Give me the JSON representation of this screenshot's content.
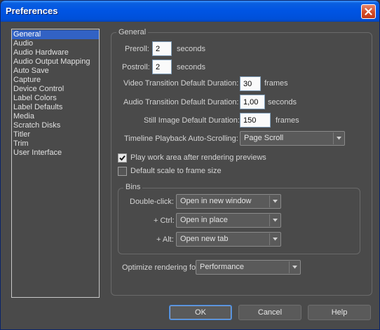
{
  "window": {
    "title": "Preferences"
  },
  "sidebar": {
    "items": [
      {
        "label": "General"
      },
      {
        "label": "Audio"
      },
      {
        "label": "Audio Hardware"
      },
      {
        "label": "Audio Output Mapping"
      },
      {
        "label": "Auto Save"
      },
      {
        "label": "Capture"
      },
      {
        "label": "Device Control"
      },
      {
        "label": "Label Colors"
      },
      {
        "label": "Label Defaults"
      },
      {
        "label": "Media"
      },
      {
        "label": "Scratch Disks"
      },
      {
        "label": "Titler"
      },
      {
        "label": "Trim"
      },
      {
        "label": "User Interface"
      }
    ],
    "selected": "General"
  },
  "general": {
    "group_title": "General",
    "preroll_label": "Preroll:",
    "preroll_value": "2",
    "preroll_unit": "seconds",
    "postroll_label": "Postroll:",
    "postroll_value": "2",
    "postroll_unit": "seconds",
    "video_trans_label": "Video Transition Default Duration:",
    "video_trans_value": "30",
    "video_trans_unit": "frames",
    "audio_trans_label": "Audio Transition Default Duration:",
    "audio_trans_value": "1,00",
    "audio_trans_unit": "seconds",
    "still_label": "Still Image Default Duration:",
    "still_value": "150",
    "still_unit": "frames",
    "autoscroll_label": "Timeline Playback Auto-Scrolling:",
    "autoscroll_value": "Page Scroll",
    "play_work_area_label": "Play work area after rendering previews",
    "play_work_area_checked": true,
    "default_scale_label": "Default scale to frame size",
    "default_scale_checked": false
  },
  "bins": {
    "group_title": "Bins",
    "double_click_label": "Double-click:",
    "double_click_value": "Open in new window",
    "ctrl_label": "+ Ctrl:",
    "ctrl_value": "Open in place",
    "alt_label": "+ Alt:",
    "alt_value": "Open new tab"
  },
  "optimize": {
    "label": "Optimize rendering for:",
    "value": "Performance"
  },
  "buttons": {
    "ok": "OK",
    "cancel": "Cancel",
    "help": "Help"
  },
  "colors": {
    "titlebar": "#0054e3",
    "selection": "#3262c4",
    "panel": "#4a4a4a"
  }
}
